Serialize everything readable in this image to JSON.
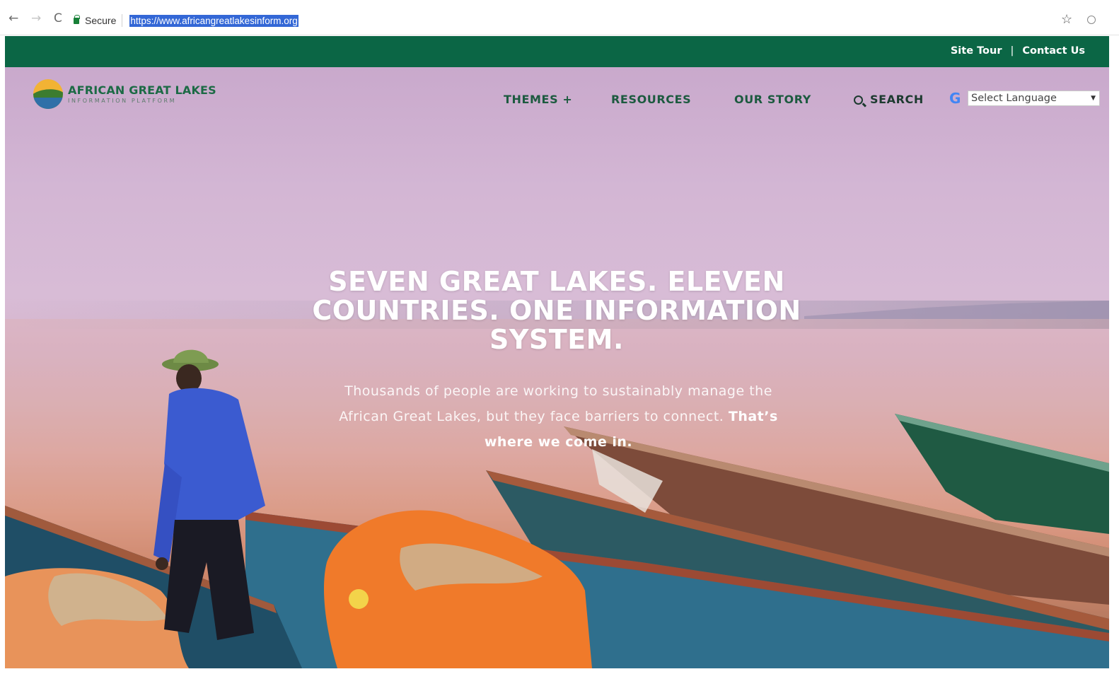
{
  "browser": {
    "secure_label": "Secure",
    "url": "https://www.africangreatlakesinform.org"
  },
  "utility_nav": {
    "site_tour": "Site Tour",
    "divider": "|",
    "contact_us": "Contact Us",
    "bar_color": "#0b6645"
  },
  "logo": {
    "title": "AFRICAN GREAT LAKES",
    "subtitle": "INFORMATION PLATFORM"
  },
  "main_nav": {
    "themes": "THEMES +",
    "resources": "RESOURCES",
    "our_story": "OUR STORY",
    "search": "SEARCH"
  },
  "language": {
    "google_glyph": "G",
    "selected": "Select Language",
    "caret": "▼"
  },
  "hero": {
    "headline": "SEVEN GREAT LAKES. ELEVEN COUNTRIES. ONE INFORMATION SYSTEM.",
    "body": "Thousands of people are working to sustainably manage the African Great Lakes, but they face barriers to connect.",
    "body_emphasis": "That’s where we come in."
  },
  "icons": [
    "back-arrow-icon",
    "forward-arrow-icon",
    "reload-icon",
    "lock-icon",
    "star-icon",
    "extension-icon",
    "search-icon",
    "google-icon"
  ]
}
